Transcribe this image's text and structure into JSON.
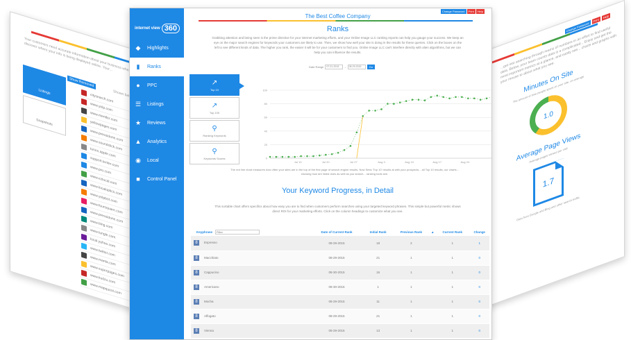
{
  "left_card": {
    "intro": "Your customers need accurate information about your business where they look... you can discover where your info is being displayed online. Your...",
    "tiles": [
      "Listings",
      "Snapshots"
    ],
    "show_removed": "Show Removed",
    "shown_label": "Shown below in list",
    "rows": [
      {
        "name": "citysearch.com",
        "color": "#c62828"
      },
      {
        "name": "www.yelp.com",
        "color": "#c62828"
      },
      {
        "name": "www.mentler.com",
        "color": "#444"
      },
      {
        "name": "yellowpages.com",
        "color": "#fbc02d"
      },
      {
        "name": "www.pressidone.com",
        "color": "#1565c0"
      },
      {
        "name": "www.soundclick.com",
        "color": "#f57c00"
      },
      {
        "name": "tunes.apple.com",
        "color": "#888"
      },
      {
        "name": "support.lenter.com",
        "color": "#1e88e5"
      },
      {
        "name": "www.pro.com",
        "color": "#1e88e5"
      },
      {
        "name": "www.ezlocal.com",
        "color": "#43a047"
      },
      {
        "name": "www.localoptics.com",
        "color": "#1565c0"
      },
      {
        "name": "www.yelpbot.com",
        "color": "#f57c00"
      },
      {
        "name": "www.foursquare.com",
        "color": "#e91e63"
      },
      {
        "name": "www.pressidone.com",
        "color": "#1565c0"
      },
      {
        "name": "www.bing.com",
        "color": "#00897b"
      },
      {
        "name": "www.tungle.com",
        "color": "#888"
      },
      {
        "name": "local.yahoo.com",
        "color": "#6a1b9a"
      },
      {
        "name": "www.twitter.com",
        "color": "#29b6f6"
      },
      {
        "name": "www.manta.com",
        "color": "#444"
      },
      {
        "name": "www.superpages.com",
        "color": "#fbc02d"
      },
      {
        "name": "www.kudzu.com",
        "color": "#c62828"
      },
      {
        "name": "www.mapquest.com",
        "color": "#43a047"
      }
    ]
  },
  "right_card": {
    "tags": [
      "Change Password",
      "Print",
      "Help"
    ],
    "text": "...get into searching through reams of numbers in an effort to find useful data. Below, your team counts data is a complicated... Enjoy and get the most important metrics at a glance, and easily see... charts and graphs with your mouse to about what you see.",
    "minutes_title": "Minutes On Site",
    "minutes_sub": "The amount of time people spent on your site, on average",
    "minutes_value": "1.0",
    "pageviews_title": "Average Page Views",
    "pageviews_sub": "Average pages viewed per visit",
    "pageviews_value": "1.7",
    "footer": "Data from Google and Bing and other search traffic."
  },
  "main": {
    "logo_text": "internet view",
    "logo_number": "360",
    "nav": [
      {
        "label": "Highlights",
        "icon": "◆",
        "name": "highlights"
      },
      {
        "label": "Ranks",
        "icon": "▮",
        "name": "ranks"
      },
      {
        "label": "PPC",
        "icon": "●",
        "name": "ppc"
      },
      {
        "label": "Listings",
        "icon": "☰",
        "name": "listings"
      },
      {
        "label": "Reviews",
        "icon": "★",
        "name": "reviews"
      },
      {
        "label": "Analytics",
        "icon": "▲",
        "name": "analytics"
      },
      {
        "label": "Local",
        "icon": "◉",
        "name": "local"
      },
      {
        "label": "Control Panel",
        "icon": "■",
        "name": "control-panel"
      }
    ],
    "top_chips": [
      "Change Password",
      "Print",
      "Help"
    ],
    "company": "The Best Coffee Company",
    "title": "Ranks",
    "description": "Grabbing attention and being seen is the prime directive for your internet marketing efforts, and your Online Image LLC ranking reports can help you gauge your success. We keep an eye on the major search engines for keywords your customers are likely to use. Then, we show how well your site is doing in the results for these queries. Click on the boxes on the left to see different kinds of data. The higher you rank, the easier it will be for your customers to find you. Online Image LLC can't interfere directly with alien algorithms, but we can help you can influence the results.",
    "date_range_label": "Date Range",
    "date_from": "07-01-2015",
    "date_to": "08-29-2015",
    "go_label": "Go",
    "tiles": [
      {
        "label": "Top 10",
        "icon": "↗",
        "name": "top-10"
      },
      {
        "label": "Top 100",
        "icon": "↗",
        "name": "top-100"
      },
      {
        "label": "Ranking Keywords",
        "icon": "⚲",
        "name": "ranking-keywords"
      },
      {
        "label": "Keywords Scores",
        "icon": "⚲",
        "name": "keywords-scores"
      }
    ],
    "chart_note": "The red line chart measures how often your sites are in the top of the first page of search engine results. Now Sees 'Top 10' results at with your prospects... all Top 10 results; our charts... showing how are listed does as well as you search... ranking tools see.",
    "section_title": "Your Keyword Progress, in Detail",
    "section_desc": "This sortable chart offers specifics about how easy you are to find when customers perform searches using your targeted keyword phrases. This simple but powerful metric shows direct ROI for your marketing efforts. Click on the column headings to customize what you see.",
    "table": {
      "headers": [
        "Keyphrase",
        "Date of Current Rank",
        "Initial Rank",
        "Previous Rank",
        "Current Rank",
        "Change"
      ],
      "filter_placeholder": "Filter",
      "rows": [
        [
          "Espresso",
          "08-29-2015",
          "18",
          "2",
          "1",
          "1"
        ],
        [
          "Macchiato",
          "08-29-2015",
          "21",
          "1",
          "1",
          "0"
        ],
        [
          "Cappucino",
          "08-30-2015",
          "16",
          "1",
          "1",
          "0"
        ],
        [
          "Americano",
          "08-30-2015",
          "1",
          "1",
          "1",
          "0"
        ],
        [
          "Mocha",
          "08-29-2015",
          "11",
          "1",
          "1",
          "0"
        ],
        [
          "Affogato",
          "08-29-2015",
          "21",
          "1",
          "1",
          "0"
        ],
        [
          "Vienna",
          "08-29-2015",
          "13",
          "1",
          "1",
          "0"
        ]
      ]
    }
  },
  "chart_data": {
    "type": "line",
    "title": "",
    "xlabel": "",
    "ylabel": "",
    "x_ticks": [
      "Jul 13",
      "Jul 20",
      "Jul 27",
      "Aug 3",
      "Aug 10",
      "Aug 17",
      "Aug 24"
    ],
    "y_ticks": [
      0,
      20,
      40,
      60,
      80,
      100
    ],
    "ylim": [
      0,
      100
    ],
    "series": [
      {
        "color": "#4caf50",
        "values": [
          2,
          2,
          2,
          2,
          2,
          3,
          3,
          3,
          4,
          5,
          6,
          8,
          12,
          18,
          38,
          62,
          70,
          70,
          72,
          80,
          80,
          82,
          84,
          86,
          86,
          85,
          90,
          92,
          90,
          88,
          90,
          90,
          88,
          88,
          86,
          88,
          90
        ]
      },
      {
        "color": "#fbc02d",
        "values": [
          null,
          null,
          null,
          null,
          null,
          null,
          null,
          null,
          null,
          null,
          null,
          null,
          null,
          null,
          0,
          62,
          null,
          null,
          null,
          null,
          null,
          null,
          null,
          null,
          null,
          null,
          null,
          null,
          null,
          null,
          null,
          null,
          null,
          null,
          null,
          null,
          null
        ]
      }
    ]
  }
}
